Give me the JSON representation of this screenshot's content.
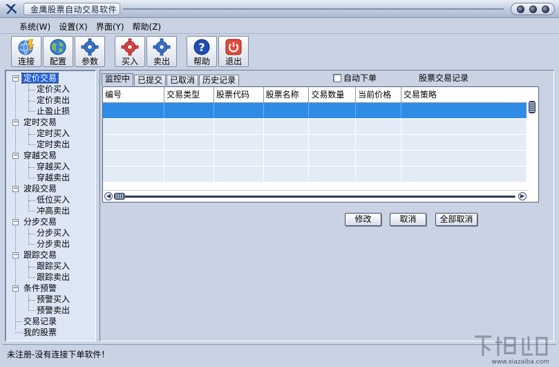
{
  "window": {
    "title": "金鹰股票自动交易软件",
    "buttons": [
      "minimize",
      "maximize",
      "close"
    ]
  },
  "menu": [
    {
      "label": "系统(W)"
    },
    {
      "label": "设置(X)"
    },
    {
      "label": "界面(Y)"
    },
    {
      "label": "帮助(Z)"
    }
  ],
  "toolbar": {
    "connect": {
      "label": "连接",
      "icon": "connect-globe-icon"
    },
    "config": {
      "label": "配置",
      "icon": "globe-icon"
    },
    "params": {
      "label": "参数",
      "icon": "gear-icon"
    },
    "buy": {
      "label": "买入",
      "icon": "buy-gear-icon"
    },
    "sell": {
      "label": "卖出",
      "icon": "sell-gear-icon"
    },
    "help": {
      "label": "帮助",
      "icon": "help-icon"
    },
    "exit": {
      "label": "退出",
      "icon": "power-icon"
    }
  },
  "tree": {
    "fixed": {
      "label": "定价交易",
      "children": [
        "定价买入",
        "定价卖出",
        "止盈止损"
      ]
    },
    "timed": {
      "label": "定时交易",
      "children": [
        "定时买入",
        "定时卖出"
      ]
    },
    "cross": {
      "label": "穿越交易",
      "children": [
        "穿越买入",
        "穿越卖出"
      ]
    },
    "band": {
      "label": "波段交易",
      "children": [
        "低位买入",
        "冲高卖出"
      ]
    },
    "step": {
      "label": "分步交易",
      "children": [
        "分步买入",
        "分步卖出"
      ]
    },
    "track": {
      "label": "跟踪交易",
      "children": [
        "跟踪买入",
        "跟踪卖出"
      ]
    },
    "alert": {
      "label": "条件预警",
      "children": [
        "预警买入",
        "预警卖出"
      ]
    },
    "records": {
      "label": "交易记录"
    },
    "stocks": {
      "label": "我的股票"
    }
  },
  "tabs": [
    "监控中",
    "已提交",
    "已取消",
    "历史记录"
  ],
  "auto_order": {
    "label": "自动下单",
    "checked": false
  },
  "records_title": "股票交易记录",
  "grid": {
    "columns": [
      "编号",
      "交易类型",
      "股票代码",
      "股票名称",
      "交易数量",
      "当前价格",
      "交易策略"
    ]
  },
  "actions": {
    "modify": "修改",
    "cancel": "取消",
    "cancel_all": "全部取消"
  },
  "status": "未注册-没有连接下单软件！",
  "watermark": {
    "site": "www.xiazaiba.com"
  },
  "colors": {
    "background": "#c9d3e3",
    "tree_background": "#dde6f5",
    "selection": "#2f8ce6",
    "grid_row": "#e3ebf7"
  }
}
